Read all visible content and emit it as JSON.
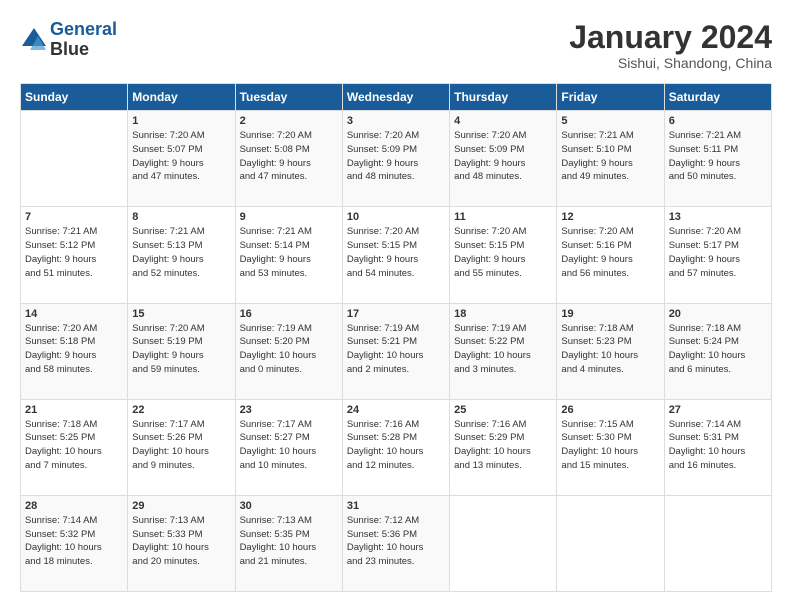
{
  "logo": {
    "line1": "General",
    "line2": "Blue"
  },
  "title": "January 2024",
  "subtitle": "Sishui, Shandong, China",
  "days_of_week": [
    "Sunday",
    "Monday",
    "Tuesday",
    "Wednesday",
    "Thursday",
    "Friday",
    "Saturday"
  ],
  "weeks": [
    [
      {
        "num": "",
        "info": ""
      },
      {
        "num": "1",
        "info": "Sunrise: 7:20 AM\nSunset: 5:07 PM\nDaylight: 9 hours\nand 47 minutes."
      },
      {
        "num": "2",
        "info": "Sunrise: 7:20 AM\nSunset: 5:08 PM\nDaylight: 9 hours\nand 47 minutes."
      },
      {
        "num": "3",
        "info": "Sunrise: 7:20 AM\nSunset: 5:09 PM\nDaylight: 9 hours\nand 48 minutes."
      },
      {
        "num": "4",
        "info": "Sunrise: 7:20 AM\nSunset: 5:09 PM\nDaylight: 9 hours\nand 48 minutes."
      },
      {
        "num": "5",
        "info": "Sunrise: 7:21 AM\nSunset: 5:10 PM\nDaylight: 9 hours\nand 49 minutes."
      },
      {
        "num": "6",
        "info": "Sunrise: 7:21 AM\nSunset: 5:11 PM\nDaylight: 9 hours\nand 50 minutes."
      }
    ],
    [
      {
        "num": "7",
        "info": "Sunrise: 7:21 AM\nSunset: 5:12 PM\nDaylight: 9 hours\nand 51 minutes."
      },
      {
        "num": "8",
        "info": "Sunrise: 7:21 AM\nSunset: 5:13 PM\nDaylight: 9 hours\nand 52 minutes."
      },
      {
        "num": "9",
        "info": "Sunrise: 7:21 AM\nSunset: 5:14 PM\nDaylight: 9 hours\nand 53 minutes."
      },
      {
        "num": "10",
        "info": "Sunrise: 7:20 AM\nSunset: 5:15 PM\nDaylight: 9 hours\nand 54 minutes."
      },
      {
        "num": "11",
        "info": "Sunrise: 7:20 AM\nSunset: 5:15 PM\nDaylight: 9 hours\nand 55 minutes."
      },
      {
        "num": "12",
        "info": "Sunrise: 7:20 AM\nSunset: 5:16 PM\nDaylight: 9 hours\nand 56 minutes."
      },
      {
        "num": "13",
        "info": "Sunrise: 7:20 AM\nSunset: 5:17 PM\nDaylight: 9 hours\nand 57 minutes."
      }
    ],
    [
      {
        "num": "14",
        "info": "Sunrise: 7:20 AM\nSunset: 5:18 PM\nDaylight: 9 hours\nand 58 minutes."
      },
      {
        "num": "15",
        "info": "Sunrise: 7:20 AM\nSunset: 5:19 PM\nDaylight: 9 hours\nand 59 minutes."
      },
      {
        "num": "16",
        "info": "Sunrise: 7:19 AM\nSunset: 5:20 PM\nDaylight: 10 hours\nand 0 minutes."
      },
      {
        "num": "17",
        "info": "Sunrise: 7:19 AM\nSunset: 5:21 PM\nDaylight: 10 hours\nand 2 minutes."
      },
      {
        "num": "18",
        "info": "Sunrise: 7:19 AM\nSunset: 5:22 PM\nDaylight: 10 hours\nand 3 minutes."
      },
      {
        "num": "19",
        "info": "Sunrise: 7:18 AM\nSunset: 5:23 PM\nDaylight: 10 hours\nand 4 minutes."
      },
      {
        "num": "20",
        "info": "Sunrise: 7:18 AM\nSunset: 5:24 PM\nDaylight: 10 hours\nand 6 minutes."
      }
    ],
    [
      {
        "num": "21",
        "info": "Sunrise: 7:18 AM\nSunset: 5:25 PM\nDaylight: 10 hours\nand 7 minutes."
      },
      {
        "num": "22",
        "info": "Sunrise: 7:17 AM\nSunset: 5:26 PM\nDaylight: 10 hours\nand 9 minutes."
      },
      {
        "num": "23",
        "info": "Sunrise: 7:17 AM\nSunset: 5:27 PM\nDaylight: 10 hours\nand 10 minutes."
      },
      {
        "num": "24",
        "info": "Sunrise: 7:16 AM\nSunset: 5:28 PM\nDaylight: 10 hours\nand 12 minutes."
      },
      {
        "num": "25",
        "info": "Sunrise: 7:16 AM\nSunset: 5:29 PM\nDaylight: 10 hours\nand 13 minutes."
      },
      {
        "num": "26",
        "info": "Sunrise: 7:15 AM\nSunset: 5:30 PM\nDaylight: 10 hours\nand 15 minutes."
      },
      {
        "num": "27",
        "info": "Sunrise: 7:14 AM\nSunset: 5:31 PM\nDaylight: 10 hours\nand 16 minutes."
      }
    ],
    [
      {
        "num": "28",
        "info": "Sunrise: 7:14 AM\nSunset: 5:32 PM\nDaylight: 10 hours\nand 18 minutes."
      },
      {
        "num": "29",
        "info": "Sunrise: 7:13 AM\nSunset: 5:33 PM\nDaylight: 10 hours\nand 20 minutes."
      },
      {
        "num": "30",
        "info": "Sunrise: 7:13 AM\nSunset: 5:35 PM\nDaylight: 10 hours\nand 21 minutes."
      },
      {
        "num": "31",
        "info": "Sunrise: 7:12 AM\nSunset: 5:36 PM\nDaylight: 10 hours\nand 23 minutes."
      },
      {
        "num": "",
        "info": ""
      },
      {
        "num": "",
        "info": ""
      },
      {
        "num": "",
        "info": ""
      }
    ]
  ]
}
